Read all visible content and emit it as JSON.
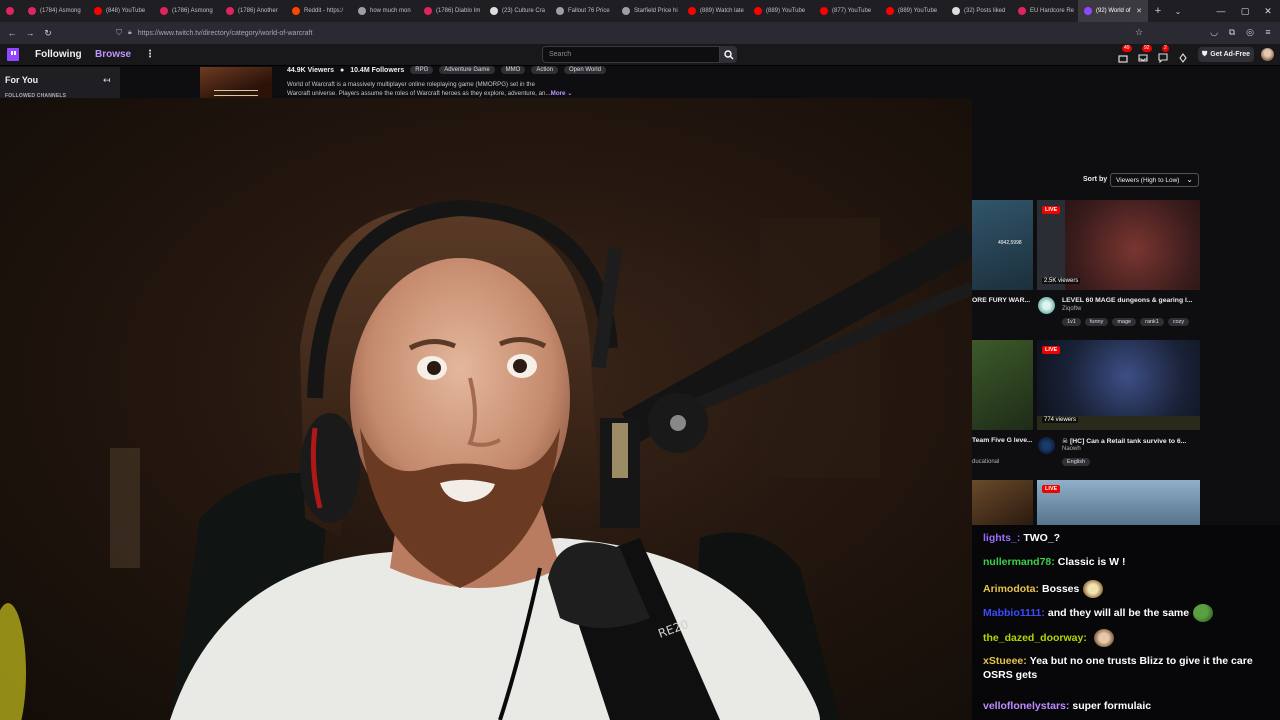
{
  "browser": {
    "tabs": [
      {
        "label": "(1784) Asmong",
        "favicon_color": "#e0245e"
      },
      {
        "label": "(848) YouTube",
        "favicon_color": "#ff0000"
      },
      {
        "label": "(1786) Asmong",
        "favicon_color": "#e0245e"
      },
      {
        "label": "(1786) Another",
        "favicon_color": "#e0245e"
      },
      {
        "label": "Reddit - https:/",
        "favicon_color": "#ff4500"
      },
      {
        "label": "how much mon",
        "favicon_color": "#9aa0a6"
      },
      {
        "label": "(1786) Diablo Im",
        "favicon_color": "#e0245e"
      },
      {
        "label": "(23) Culture Cra",
        "favicon_color": "#dddddd"
      },
      {
        "label": "Fallout 76 Price",
        "favicon_color": "#9aa0a6"
      },
      {
        "label": "Starfield Price hi",
        "favicon_color": "#9aa0a6"
      },
      {
        "label": "(889) Watch late",
        "favicon_color": "#ff0000"
      },
      {
        "label": "(889) YouTube",
        "favicon_color": "#ff0000"
      },
      {
        "label": "(877) YouTube",
        "favicon_color": "#ff0000"
      },
      {
        "label": "(889) YouTube",
        "favicon_color": "#ff0000"
      },
      {
        "label": "(32) Posts liked",
        "favicon_color": "#dddddd"
      },
      {
        "label": "EU Hardcore Re",
        "favicon_color": "#e0245e"
      },
      {
        "label": "(92) World of",
        "favicon_color": "#9147ff",
        "active": true
      }
    ],
    "url": "https://www.twitch.tv/directory/category/world-of-warcraft"
  },
  "twitch_nav": {
    "following": "Following",
    "browse": "Browse",
    "search_placeholder": "Search",
    "badges": [
      "49",
      "92",
      "2"
    ],
    "ad_free": "Get Ad-Free"
  },
  "sidebar": {
    "for_you": "For You",
    "followed_channels": "FOLLOWED CHANNELS"
  },
  "category": {
    "viewers": "44.9K Viewers",
    "followers": "10.4M Followers",
    "tags": [
      "RPG",
      "Adventure Game",
      "MMO",
      "Action",
      "Open World"
    ],
    "description_line1": "World of Warcraft is a massively multiplayer online roleplaying game (MMORPG) set in the",
    "description_line2": "Warcraft universe. Players assume the roles of Warcraft heroes as they explore, adventure, an...",
    "more": "More"
  },
  "sort": {
    "label": "Sort by",
    "value": "Viewers (High to Low)"
  },
  "streams": [
    {
      "live_label": "LIVE",
      "viewers": "2.5K viewers",
      "title": "LEVEL 60 MAGE dungeons & gearing l...",
      "channel": "Ziqoftw",
      "tags": [
        "1v1",
        "funny",
        "mage",
        "rank1",
        "cozy"
      ],
      "left_title": "ORE FURY WAR...",
      "left_thumb_text": "4942,5998"
    },
    {
      "live_label": "LIVE",
      "viewers": "774 viewers",
      "title": "[HC] Can a Retail tank survive to 6...",
      "channel": "Naowh",
      "tags": [
        "English"
      ],
      "left_title": "Team Five G leve...",
      "left_tag": "ducational"
    },
    {
      "live_label": "LIVE"
    }
  ],
  "chat": [
    {
      "user": "lights_:",
      "text": "TWO_?",
      "color": "#9b6cff"
    },
    {
      "user": "nullermand78:",
      "text": "Classic is W !",
      "color": "#3ad04a"
    },
    {
      "user": "Arimodota:",
      "text": "Bosses",
      "color": "#e8c24a",
      "emote": "laughing-face-emote"
    },
    {
      "user": "Mabbio1111:",
      "text": "and they will all be the same",
      "color": "#3b4cff",
      "emote": "pepe-frog-emote"
    },
    {
      "user": "the_dazed_doorway:",
      "text": "",
      "color": "#b8d400",
      "emote": "face-emote"
    },
    {
      "user": "xStueee:",
      "text": "Yea but no one trusts Blizz to give it the care OSRS gets",
      "color": "#e8c24a"
    },
    {
      "user": "velloflonelystars:",
      "text": "super formulaic",
      "color": "#c08cff"
    }
  ],
  "colors": {
    "twitch_purple": "#9147ff",
    "live_red": "#eb0400",
    "background": "#0e0e10"
  }
}
